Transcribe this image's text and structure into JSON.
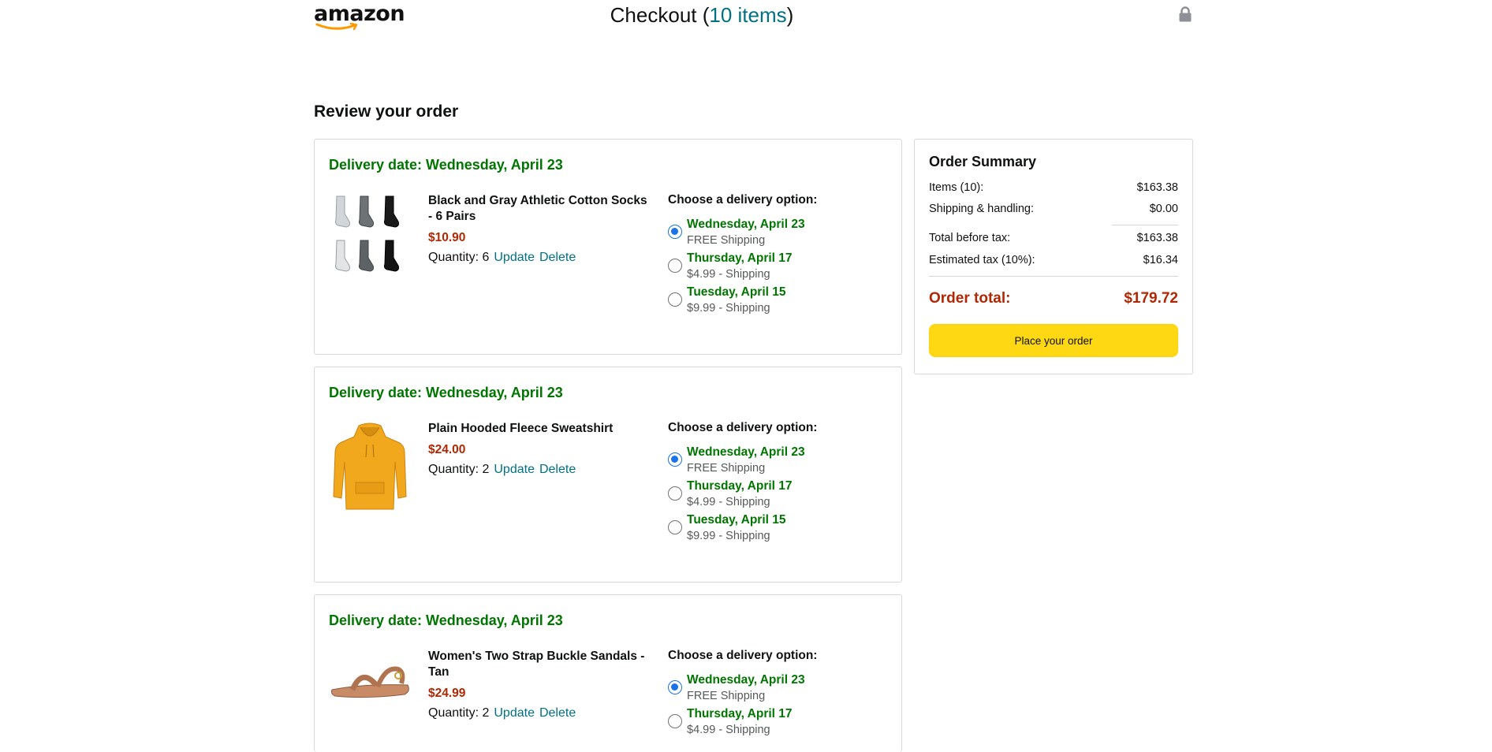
{
  "header": {
    "logo_text": "amazon",
    "title_prefix": "Checkout (",
    "items_count_text": "10 items",
    "title_suffix": ")",
    "lock_icon": "lock-icon"
  },
  "review_title": "Review your order",
  "items": [
    {
      "delivery_date": "Delivery date: Wednesday, April 23",
      "name": "Black and Gray Athletic Cotton Socks - 6 Pairs",
      "price": "$10.90",
      "quantity": "Quantity: 6",
      "update_label": "Update",
      "delete_label": "Delete",
      "options_heading": "Choose a delivery option:",
      "options": [
        {
          "date": "Wednesday, April 23",
          "shipping": "FREE Shipping",
          "selected": true
        },
        {
          "date": "Thursday, April 17",
          "shipping": "$4.99 - Shipping",
          "selected": false
        },
        {
          "date": "Tuesday, April 15",
          "shipping": "$9.99 - Shipping",
          "selected": false
        }
      ]
    },
    {
      "delivery_date": "Delivery date: Wednesday, April 23",
      "name": "Plain Hooded Fleece Sweatshirt",
      "price": "$24.00",
      "quantity": "Quantity: 2",
      "update_label": "Update",
      "delete_label": "Delete",
      "options_heading": "Choose a delivery option:",
      "options": [
        {
          "date": "Wednesday, April 23",
          "shipping": "FREE Shipping",
          "selected": true
        },
        {
          "date": "Thursday, April 17",
          "shipping": "$4.99 - Shipping",
          "selected": false
        },
        {
          "date": "Tuesday, April 15",
          "shipping": "$9.99 - Shipping",
          "selected": false
        }
      ]
    },
    {
      "delivery_date": "Delivery date: Wednesday, April 23",
      "name": "Women's Two Strap Buckle Sandals - Tan",
      "price": "$24.99",
      "quantity": "Quantity: 2",
      "update_label": "Update",
      "delete_label": "Delete",
      "options_heading": "Choose a delivery option:",
      "options": [
        {
          "date": "Wednesday, April 23",
          "shipping": "FREE Shipping",
          "selected": true
        },
        {
          "date": "Thursday, April 17",
          "shipping": "$4.99 - Shipping",
          "selected": false
        }
      ]
    }
  ],
  "summary": {
    "title": "Order Summary",
    "items_label": "Items (10):",
    "items_value": "$163.38",
    "shipping_label": "Shipping & handling:",
    "shipping_value": "$0.00",
    "before_tax_label": "Total before tax:",
    "before_tax_value": "$163.38",
    "tax_label": "Estimated tax (10%):",
    "tax_value": "$16.34",
    "total_label": "Order total:",
    "total_value": "$179.72",
    "place_order_label": "Place your order"
  },
  "colors": {
    "link": "#007185",
    "delivery_green": "#007600",
    "price_red": "#b12704",
    "button_yellow": "#ffd814",
    "radio_blue": "#1a73e8"
  }
}
